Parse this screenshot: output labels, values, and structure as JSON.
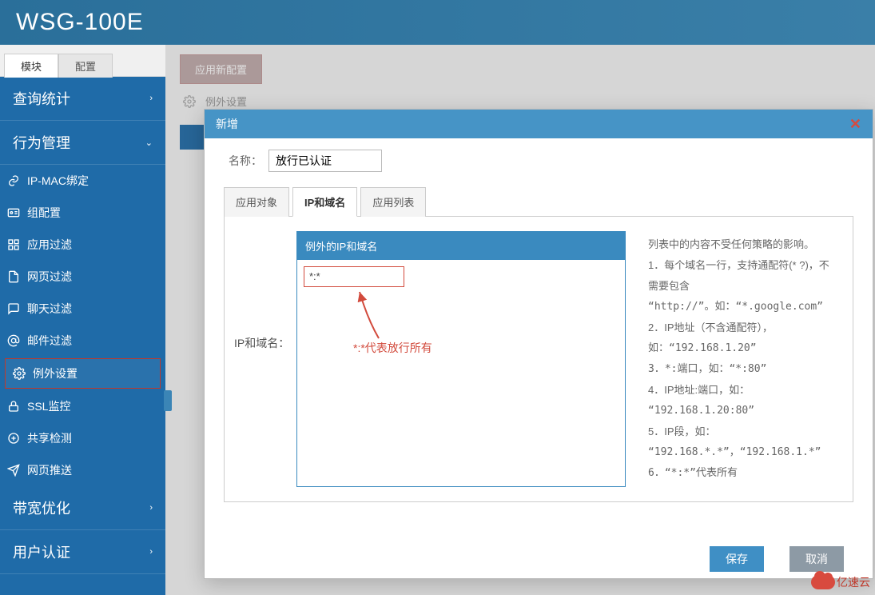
{
  "header": {
    "title": "WSG-100E"
  },
  "sidebar": {
    "tabs": {
      "module": "模块",
      "config": "配置"
    },
    "groups": {
      "query": "查询统计",
      "behavior": "行为管理",
      "bandwidth": "带宽优化",
      "auth": "用户认证"
    },
    "behavior_items": [
      {
        "icon": "link",
        "label": "IP-MAC绑定"
      },
      {
        "icon": "idcard",
        "label": "组配置"
      },
      {
        "icon": "grid",
        "label": "应用过滤"
      },
      {
        "icon": "page",
        "label": "网页过滤"
      },
      {
        "icon": "chat",
        "label": "聊天过滤"
      },
      {
        "icon": "at",
        "label": "邮件过滤"
      },
      {
        "icon": "gear",
        "label": "例外设置"
      },
      {
        "icon": "lock",
        "label": "SSL监控"
      },
      {
        "icon": "share",
        "label": "共享检测"
      },
      {
        "icon": "send",
        "label": "网页推送"
      }
    ]
  },
  "content": {
    "apply_btn": "应用新配置",
    "crumb": "例外设置"
  },
  "modal": {
    "title": "新增",
    "name_label": "名称：",
    "name_value": "放行已认证",
    "tabs": {
      "t1": "应用对象",
      "t2": "IP和域名",
      "t3": "应用列表"
    },
    "ip_label": "IP和域名：",
    "domain_header": "例外的IP和域名",
    "domain_text": "*:*",
    "arrow_note": "*:*代表放行所有",
    "help": {
      "l0": "列表中的内容不受任何策略的影响。",
      "l1": "1．每个域名一行，支持通配符(* ?)，不需要包含",
      "l1b": "“http://”。如：“*.google.com”",
      "l2": "2．IP地址（不含通配符），",
      "l2b": "如：“192.168.1.20”",
      "l3": "3．*:端口，如：“*:80”",
      "l4": "4．IP地址:端口，如：",
      "l4b": "“192.168.1.20:80”",
      "l5": "5．IP段，如：",
      "l5b": "“192.168.*.*”，“192.168.1.*”",
      "l6": "6．“*:*”代表所有"
    },
    "save": "保存",
    "cancel": "取消"
  },
  "watermark": "亿速云"
}
